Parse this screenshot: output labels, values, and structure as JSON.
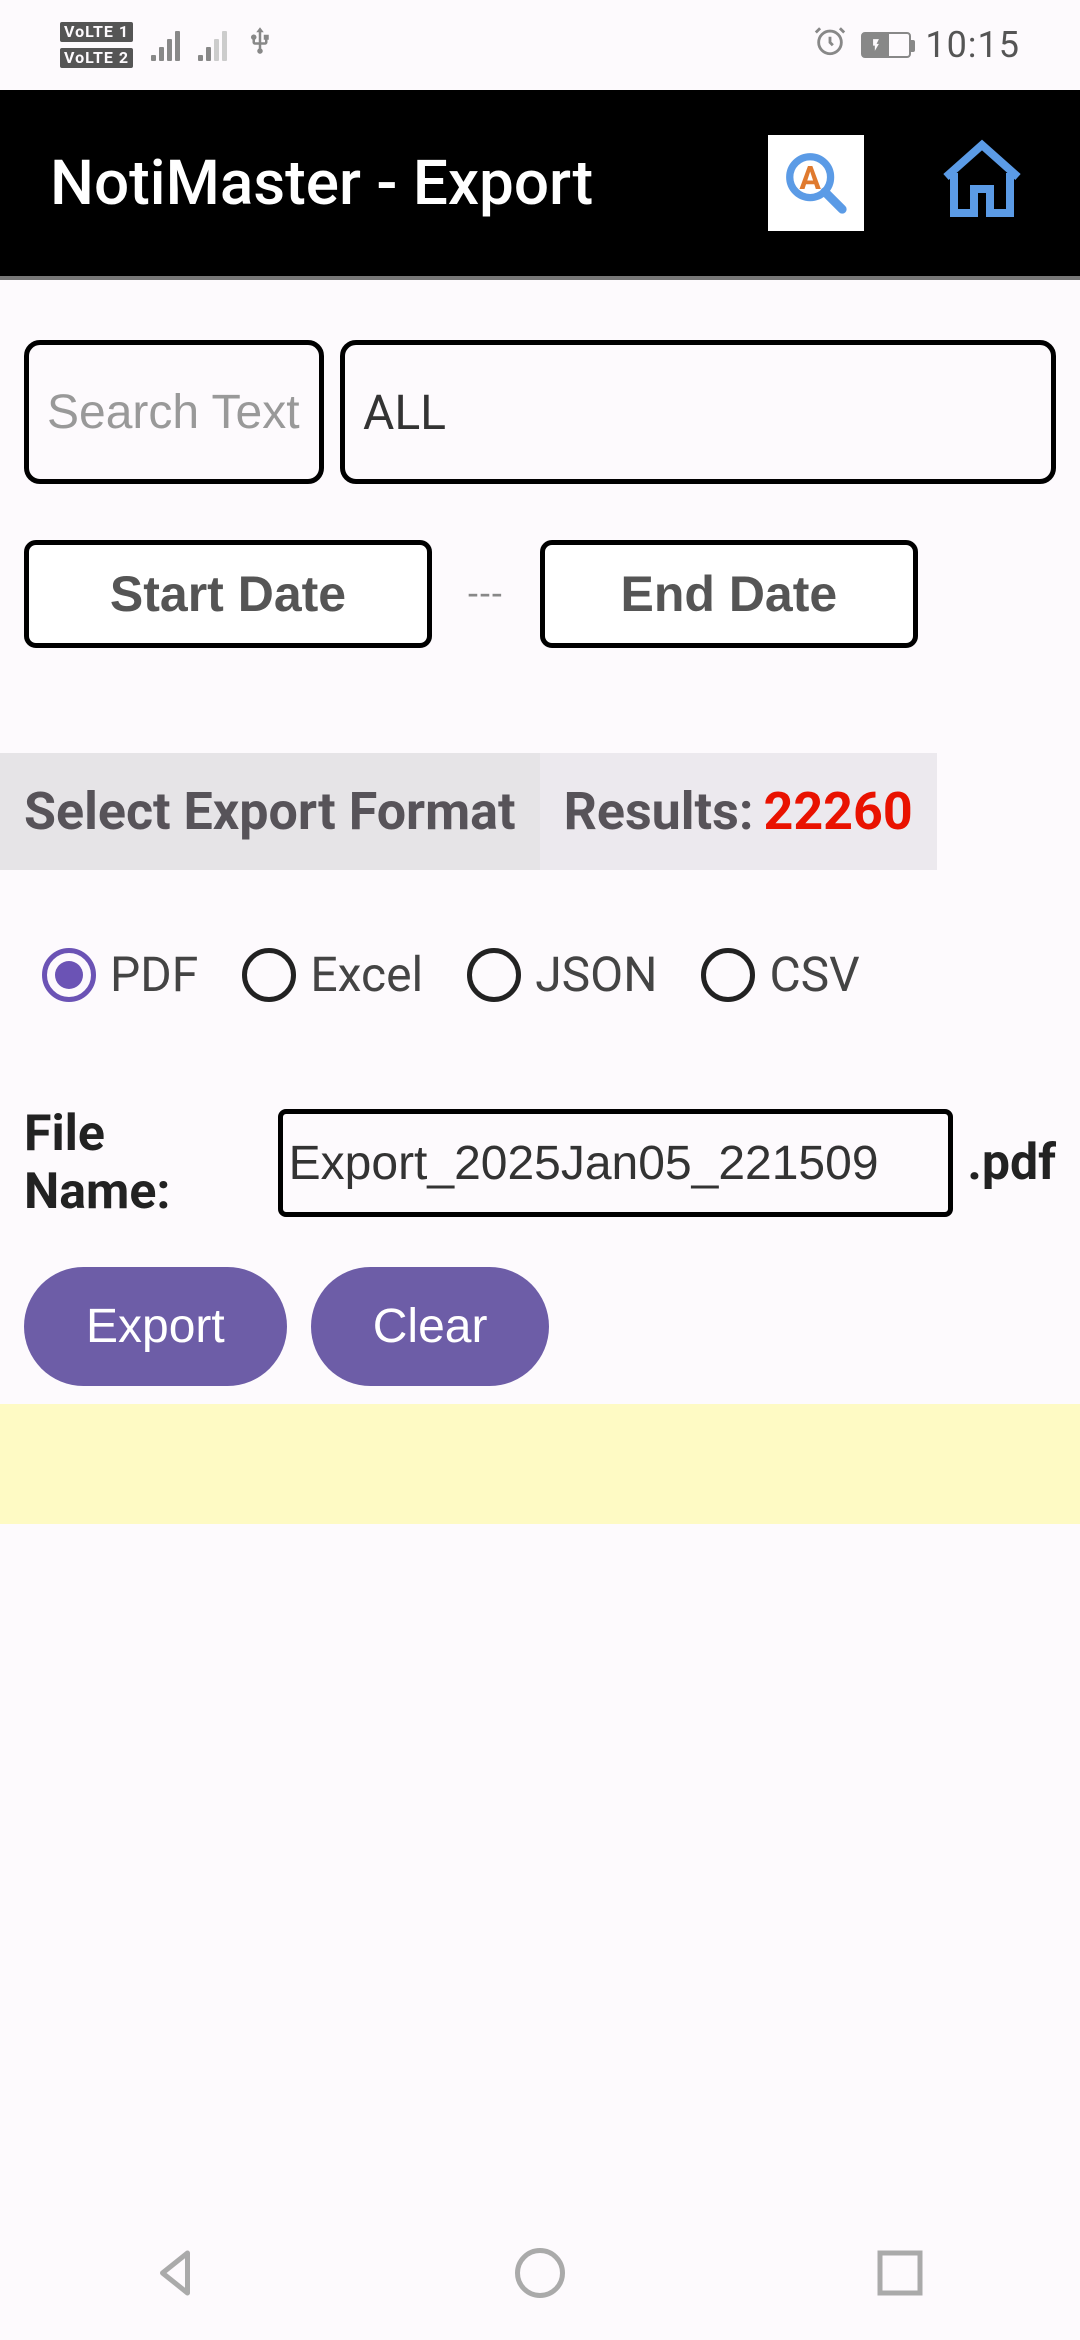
{
  "status": {
    "volte1": "VoLTE 1",
    "volte2": "VoLTE 2",
    "time": "10:15"
  },
  "header": {
    "title": "NotiMaster - Export"
  },
  "filters": {
    "search_placeholder": "Search Text",
    "scope_value": "ALL",
    "start_date_label": "Start Date",
    "end_date_label": "End Date",
    "separator": "---"
  },
  "format": {
    "label": "Select Export Format",
    "results_label": "Results:",
    "results_count": "22260",
    "options": [
      {
        "label": "PDF",
        "selected": true
      },
      {
        "label": "Excel",
        "selected": false
      },
      {
        "label": "JSON",
        "selected": false
      },
      {
        "label": "CSV",
        "selected": false
      }
    ]
  },
  "file": {
    "label": "File Name:",
    "value": "Export_2025Jan05_221509",
    "extension": ".pdf"
  },
  "actions": {
    "export": "Export",
    "clear": "Clear"
  }
}
